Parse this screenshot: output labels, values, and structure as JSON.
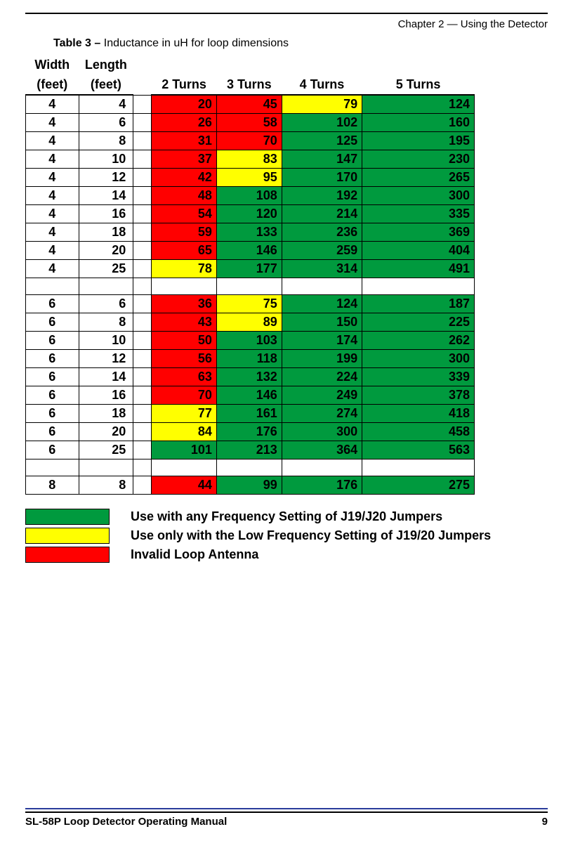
{
  "header": {
    "chapter": "Chapter 2 — Using the Detector"
  },
  "caption": {
    "bold": "Table 3 –",
    "rest": " Inductance in uH for loop dimensions"
  },
  "columns": {
    "width_top": "Width",
    "width_bot": "(feet)",
    "length_top": "Length",
    "length_bot": "(feet)",
    "t2": "2 Turns",
    "t3": "3 Turns",
    "t4": "4 Turns",
    "t5": "5 Turns"
  },
  "legend": {
    "green": "Use with any Frequency Setting of J19/J20 Jumpers",
    "yellow": "Use only with the Low Frequency Setting of J19/20 Jumpers",
    "red": "Invalid Loop Antenna"
  },
  "footer": {
    "manual": "SL-58P Loop Detector Operating Manual",
    "page": "9"
  },
  "chart_data": {
    "type": "table",
    "title": "Inductance in uH for loop dimensions",
    "columns": [
      "Width (feet)",
      "Length (feet)",
      "2 Turns",
      "3 Turns",
      "4 Turns",
      "5 Turns"
    ],
    "color_meaning": {
      "green": "Use with any Frequency Setting of J19/J20 Jumpers",
      "yellow": "Use only with the Low Frequency Setting of J19/20 Jumpers",
      "red": "Invalid Loop Antenna"
    },
    "rows": [
      {
        "w": 4,
        "l": 4,
        "t2": {
          "v": 20,
          "c": "red"
        },
        "t3": {
          "v": 45,
          "c": "red"
        },
        "t4": {
          "v": 79,
          "c": "yellow"
        },
        "t5": {
          "v": 124,
          "c": "green"
        }
      },
      {
        "w": 4,
        "l": 6,
        "t2": {
          "v": 26,
          "c": "red"
        },
        "t3": {
          "v": 58,
          "c": "red"
        },
        "t4": {
          "v": 102,
          "c": "green"
        },
        "t5": {
          "v": 160,
          "c": "green"
        }
      },
      {
        "w": 4,
        "l": 8,
        "t2": {
          "v": 31,
          "c": "red"
        },
        "t3": {
          "v": 70,
          "c": "red"
        },
        "t4": {
          "v": 125,
          "c": "green"
        },
        "t5": {
          "v": 195,
          "c": "green"
        }
      },
      {
        "w": 4,
        "l": 10,
        "t2": {
          "v": 37,
          "c": "red"
        },
        "t3": {
          "v": 83,
          "c": "yellow"
        },
        "t4": {
          "v": 147,
          "c": "green"
        },
        "t5": {
          "v": 230,
          "c": "green"
        }
      },
      {
        "w": 4,
        "l": 12,
        "t2": {
          "v": 42,
          "c": "red"
        },
        "t3": {
          "v": 95,
          "c": "yellow"
        },
        "t4": {
          "v": 170,
          "c": "green"
        },
        "t5": {
          "v": 265,
          "c": "green"
        }
      },
      {
        "w": 4,
        "l": 14,
        "t2": {
          "v": 48,
          "c": "red"
        },
        "t3": {
          "v": 108,
          "c": "green"
        },
        "t4": {
          "v": 192,
          "c": "green"
        },
        "t5": {
          "v": 300,
          "c": "green"
        }
      },
      {
        "w": 4,
        "l": 16,
        "t2": {
          "v": 54,
          "c": "red"
        },
        "t3": {
          "v": 120,
          "c": "green"
        },
        "t4": {
          "v": 214,
          "c": "green"
        },
        "t5": {
          "v": 335,
          "c": "green"
        }
      },
      {
        "w": 4,
        "l": 18,
        "t2": {
          "v": 59,
          "c": "red"
        },
        "t3": {
          "v": 133,
          "c": "green"
        },
        "t4": {
          "v": 236,
          "c": "green"
        },
        "t5": {
          "v": 369,
          "c": "green"
        }
      },
      {
        "w": 4,
        "l": 20,
        "t2": {
          "v": 65,
          "c": "red"
        },
        "t3": {
          "v": 146,
          "c": "green"
        },
        "t4": {
          "v": 259,
          "c": "green"
        },
        "t5": {
          "v": 404,
          "c": "green"
        }
      },
      {
        "w": 4,
        "l": 25,
        "t2": {
          "v": 78,
          "c": "yellow"
        },
        "t3": {
          "v": 177,
          "c": "green"
        },
        "t4": {
          "v": 314,
          "c": "green"
        },
        "t5": {
          "v": 491,
          "c": "green"
        }
      },
      {
        "sep": true
      },
      {
        "w": 6,
        "l": 6,
        "t2": {
          "v": 36,
          "c": "red"
        },
        "t3": {
          "v": 75,
          "c": "yellow"
        },
        "t4": {
          "v": 124,
          "c": "green"
        },
        "t5": {
          "v": 187,
          "c": "green"
        }
      },
      {
        "w": 6,
        "l": 8,
        "t2": {
          "v": 43,
          "c": "red"
        },
        "t3": {
          "v": 89,
          "c": "yellow"
        },
        "t4": {
          "v": 150,
          "c": "green"
        },
        "t5": {
          "v": 225,
          "c": "green"
        }
      },
      {
        "w": 6,
        "l": 10,
        "t2": {
          "v": 50,
          "c": "red"
        },
        "t3": {
          "v": 103,
          "c": "green"
        },
        "t4": {
          "v": 174,
          "c": "green"
        },
        "t5": {
          "v": 262,
          "c": "green"
        }
      },
      {
        "w": 6,
        "l": 12,
        "t2": {
          "v": 56,
          "c": "red"
        },
        "t3": {
          "v": 118,
          "c": "green"
        },
        "t4": {
          "v": 199,
          "c": "green"
        },
        "t5": {
          "v": 300,
          "c": "green"
        }
      },
      {
        "w": 6,
        "l": 14,
        "t2": {
          "v": 63,
          "c": "red"
        },
        "t3": {
          "v": 132,
          "c": "green"
        },
        "t4": {
          "v": 224,
          "c": "green"
        },
        "t5": {
          "v": 339,
          "c": "green"
        }
      },
      {
        "w": 6,
        "l": 16,
        "t2": {
          "v": 70,
          "c": "red"
        },
        "t3": {
          "v": 146,
          "c": "green"
        },
        "t4": {
          "v": 249,
          "c": "green"
        },
        "t5": {
          "v": 378,
          "c": "green"
        }
      },
      {
        "w": 6,
        "l": 18,
        "t2": {
          "v": 77,
          "c": "yellow"
        },
        "t3": {
          "v": 161,
          "c": "green"
        },
        "t4": {
          "v": 274,
          "c": "green"
        },
        "t5": {
          "v": 418,
          "c": "green"
        }
      },
      {
        "w": 6,
        "l": 20,
        "t2": {
          "v": 84,
          "c": "yellow"
        },
        "t3": {
          "v": 176,
          "c": "green"
        },
        "t4": {
          "v": 300,
          "c": "green"
        },
        "t5": {
          "v": 458,
          "c": "green"
        }
      },
      {
        "w": 6,
        "l": 25,
        "t2": {
          "v": 101,
          "c": "green"
        },
        "t3": {
          "v": 213,
          "c": "green"
        },
        "t4": {
          "v": 364,
          "c": "green"
        },
        "t5": {
          "v": 563,
          "c": "green"
        }
      },
      {
        "sep": true
      },
      {
        "w": 8,
        "l": 8,
        "t2": {
          "v": 44,
          "c": "red"
        },
        "t3": {
          "v": 99,
          "c": "green"
        },
        "t4": {
          "v": 176,
          "c": "green"
        },
        "t5": {
          "v": 275,
          "c": "green"
        }
      }
    ]
  }
}
